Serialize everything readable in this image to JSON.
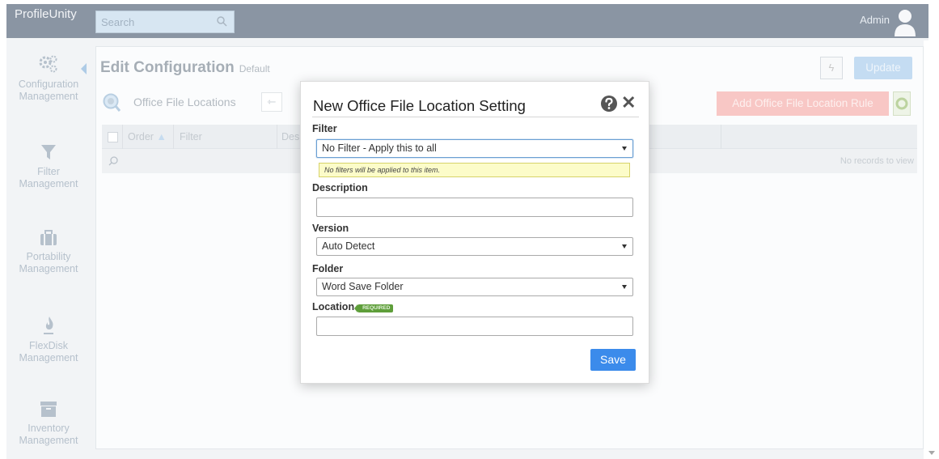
{
  "app": {
    "brand": "ProfileUnity",
    "user": "Admin"
  },
  "search": {
    "placeholder": "Search"
  },
  "sidebar": {
    "items": [
      {
        "line1": "Configuration",
        "line2": "Management",
        "icon": "gears-icon"
      },
      {
        "line1": "Filter",
        "line2": "Management",
        "icon": "filter-icon"
      },
      {
        "line1": "Portability",
        "line2": "Management",
        "icon": "briefcase-icon"
      },
      {
        "line1": "FlexDisk",
        "line2": "Management",
        "icon": "flame-icon"
      },
      {
        "line1": "Inventory",
        "line2": "Management",
        "icon": "archive-icon"
      }
    ]
  },
  "page": {
    "title": "Edit Configuration",
    "subtitle": "Default",
    "update_label": "Update",
    "section_title": "Office File Locations",
    "add_rule_label": "Add Office File Location Rule"
  },
  "grid": {
    "columns": [
      "Order",
      "Filter",
      "Des"
    ],
    "empty_text": "No records to view"
  },
  "modal": {
    "title": "New Office File Location Setting",
    "filter_label": "Filter",
    "filter_value": "No Filter - Apply this to all",
    "filter_hint": "No filters will be applied to this item.",
    "description_label": "Description",
    "description_value": "",
    "version_label": "Version",
    "version_value": "Auto Detect",
    "folder_label": "Folder",
    "folder_value": "Word Save Folder",
    "location_label": "Location",
    "required_badge": "REQUIRED",
    "location_value": "",
    "save_label": "Save"
  },
  "colors": {
    "accent": "#3b8beb",
    "topbar": "#8a95a3",
    "required": "#5e9e3a"
  }
}
